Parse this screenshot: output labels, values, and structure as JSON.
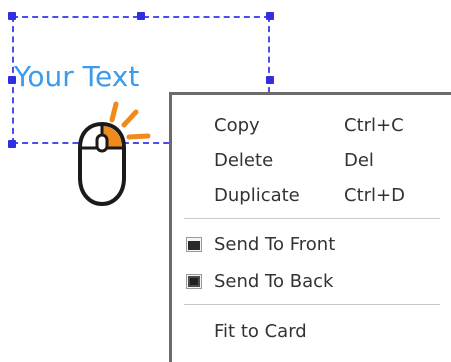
{
  "canvas": {
    "text": "Your Text",
    "text_color": "#3d9be9",
    "selection_color": "#4c4cf0"
  },
  "icons": {
    "cursor": "mouse-left-click-icon",
    "send_to_front": "send-to-front-icon",
    "send_to_back": "send-to-back-icon"
  },
  "context_menu": {
    "items": [
      {
        "label": "Copy",
        "shortcut": "Ctrl+C"
      },
      {
        "label": "Delete",
        "shortcut": "Del"
      },
      {
        "label": "Duplicate",
        "shortcut": "Ctrl+D"
      },
      {
        "label": "Send To Front",
        "shortcut": ""
      },
      {
        "label": "Send To Back",
        "shortcut": ""
      },
      {
        "label": "Fit to Card",
        "shortcut": ""
      }
    ]
  }
}
